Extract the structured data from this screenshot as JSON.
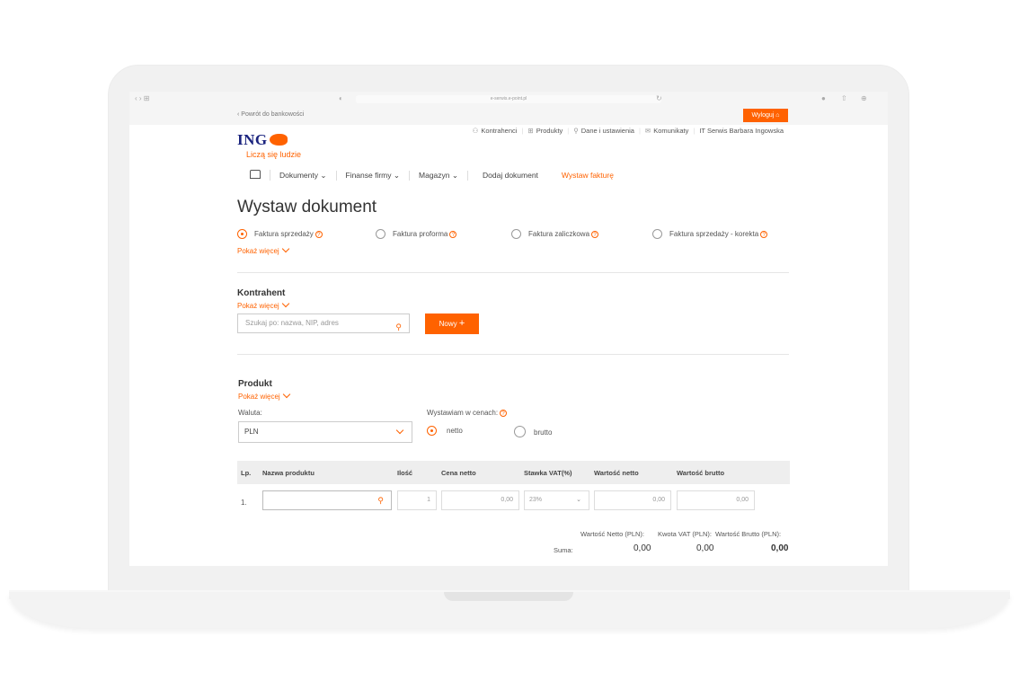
{
  "browser": {
    "url": "e-serwis.e-point.pl",
    "controls_left": "‹ ›   ⊞"
  },
  "header": {
    "back_link": "Powrót do bankowości",
    "logout_label": "Wyloguj",
    "logo_text": "ING",
    "logo_tagline": "Liczą się ludzie",
    "top_links": [
      {
        "label": "Kontrahenci",
        "icon": "people-icon"
      },
      {
        "label": "Produkty",
        "icon": "grid-icon"
      },
      {
        "label": "Dane i ustawienia",
        "icon": "user-icon"
      },
      {
        "label": "Komunikaty",
        "icon": "mail-icon"
      },
      {
        "label": "IT Serwis Barbara Ingowska",
        "icon": ""
      }
    ]
  },
  "nav": {
    "items": [
      {
        "label": "Dokumenty",
        "has_dropdown": true
      },
      {
        "label": "Finanse firmy",
        "has_dropdown": true
      },
      {
        "label": "Magazyn",
        "has_dropdown": true
      },
      {
        "label": "Dodaj dokument",
        "has_dropdown": false
      },
      {
        "label": "Wystaw fakturę",
        "has_dropdown": false,
        "active": true
      }
    ]
  },
  "page": {
    "title": "Wystaw dokument",
    "doc_types": [
      {
        "label": "Faktura sprzedaży",
        "selected": true
      },
      {
        "label": "Faktura proforma",
        "selected": false
      },
      {
        "label": "Faktura zaliczkowa",
        "selected": false
      },
      {
        "label": "Faktura sprzedaży - korekta",
        "selected": false
      }
    ],
    "show_more": "Pokaż więcej"
  },
  "contractor": {
    "title": "Kontrahent",
    "show_more": "Pokaż więcej",
    "search_placeholder": "Szukaj po: nazwa, NIP, adres",
    "new_button": "Nowy"
  },
  "product": {
    "title": "Produkt",
    "show_more": "Pokaż więcej",
    "currency_label": "Waluta:",
    "currency_value": "PLN",
    "price_mode_label": "Wystawiam w cenach:",
    "price_modes": [
      {
        "label": "netto",
        "selected": true
      },
      {
        "label": "brutto",
        "selected": false
      }
    ],
    "table": {
      "headers": [
        "Lp.",
        "Nazwa produktu",
        "Ilość",
        "Cena netto",
        "Stawka VAT(%)",
        "Wartość netto",
        "Wartość brutto"
      ],
      "row": {
        "lp": "1.",
        "name": "",
        "qty": "1",
        "net_price": "0,00",
        "vat": "23%",
        "net_value": "0,00",
        "gross_value": "0,00"
      }
    },
    "summary": {
      "headers": [
        "Wartość Netto (PLN):",
        "Kwota VAT (PLN):",
        "Wartość Brutto (PLN):"
      ],
      "label": "Suma:",
      "net": "0,00",
      "vat": "0,00",
      "gross": "0,00"
    }
  },
  "colors": {
    "accent": "#ff6200",
    "brand_blue": "#1a237e"
  }
}
